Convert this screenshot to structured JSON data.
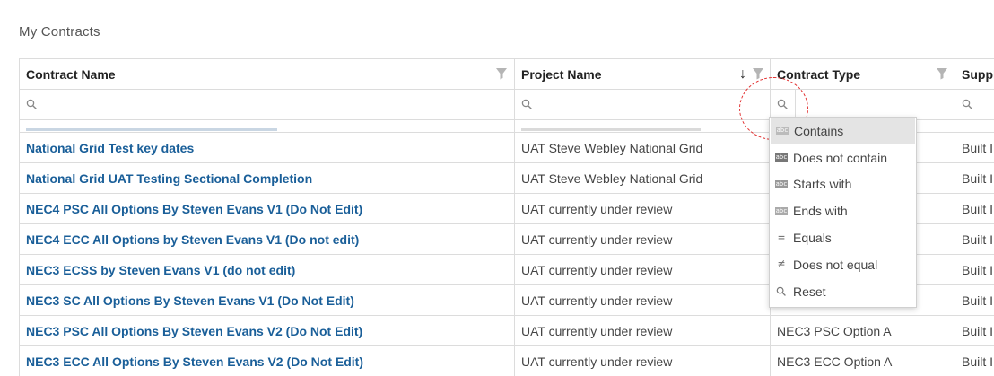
{
  "page": {
    "title": "My Contracts"
  },
  "columns": [
    {
      "label": "Contract Name"
    },
    {
      "label": "Project Name"
    },
    {
      "label": "Contract Type"
    },
    {
      "label": "Suppl"
    }
  ],
  "rows": [
    {
      "contract": "National Grid Test key dates",
      "project": "UAT Steve Webley National Grid",
      "type": "",
      "supplier": "Built I"
    },
    {
      "contract": "National Grid UAT Testing Sectional Completion",
      "project": "UAT Steve Webley National Grid",
      "type": "",
      "supplier": "Built I"
    },
    {
      "contract": "NEC4 PSC All Options By Steven Evans V1 (Do Not Edit)",
      "project": "UAT currently under review",
      "type": "",
      "supplier": "Built I"
    },
    {
      "contract": "NEC4 ECC All Options by Steven Evans V1 (Do not edit)",
      "project": "UAT currently under review",
      "type": "",
      "supplier": "Built I"
    },
    {
      "contract": "NEC3 ECSS by Steven Evans V1 (do not edit)",
      "project": "UAT currently under review",
      "type": "",
      "supplier": "Built I"
    },
    {
      "contract": "NEC3 SC All Options By Steven Evans V1 (Do Not Edit)",
      "project": "UAT currently under review",
      "type": "",
      "supplier": "Built I"
    },
    {
      "contract": "NEC3 PSC All Options By Steven Evans V2 (Do Not Edit)",
      "project": "UAT currently under review",
      "type": "NEC3 PSC Option A",
      "supplier": "Built I"
    },
    {
      "contract": "NEC3 ECC All Options By Steven Evans V2 (Do Not Edit)",
      "project": "UAT currently under review",
      "type": "NEC3 ECC Option A",
      "supplier": "Built I"
    }
  ],
  "filter_menu": {
    "items": [
      {
        "label": "Contains",
        "icon": "contains-icon"
      },
      {
        "label": "Does not contain",
        "icon": "does-not-contain-icon"
      },
      {
        "label": "Starts with",
        "icon": "starts-with-icon"
      },
      {
        "label": "Ends with",
        "icon": "ends-with-icon"
      },
      {
        "label": "Equals",
        "icon": "equals-icon"
      },
      {
        "label": "Does not equal",
        "icon": "not-equal-icon"
      },
      {
        "label": "Reset",
        "icon": "search-icon"
      }
    ],
    "icon_text": {
      "abc": "abc"
    },
    "selected": "Contains"
  },
  "colors": {
    "link": "#1a5f99",
    "border": "#dcdcdc",
    "highlight_ring": "#e23030",
    "menu_active": "#e4e4e4"
  }
}
